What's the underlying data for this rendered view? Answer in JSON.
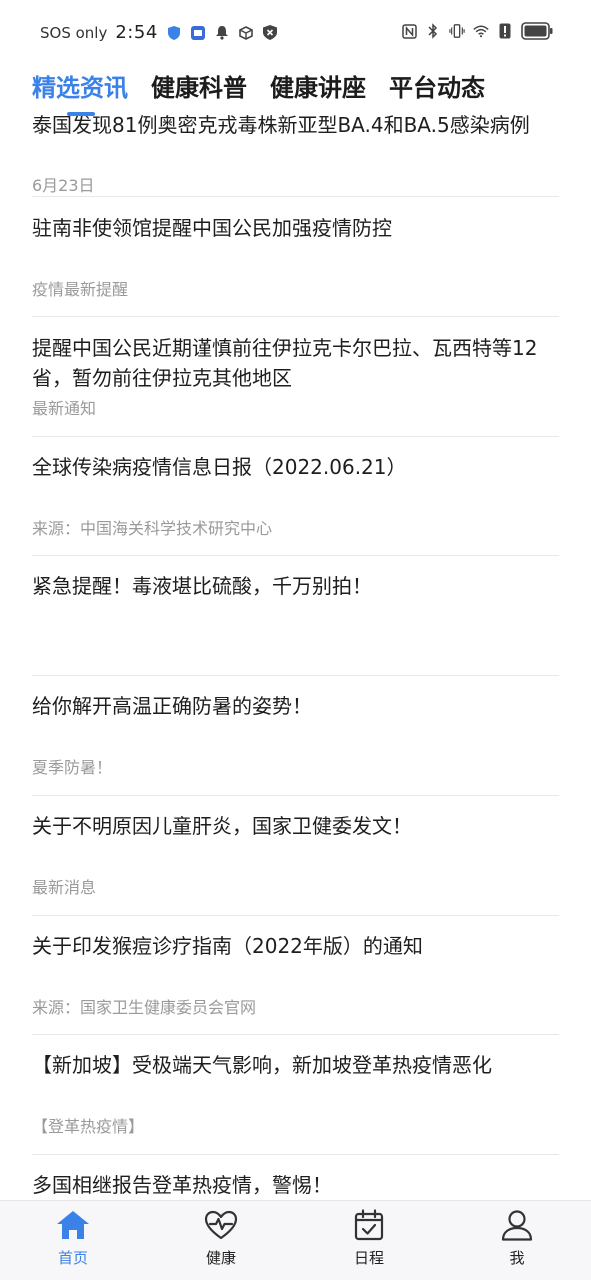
{
  "status": {
    "carrier": "SOS only",
    "time": "2:54"
  },
  "tabs": [
    {
      "label": "精选资讯",
      "active": true
    },
    {
      "label": "健康科普",
      "active": false
    },
    {
      "label": "健康讲座",
      "active": false
    },
    {
      "label": "平台动态",
      "active": false
    }
  ],
  "articles": [
    {
      "title": "泰国发现81例奥密克戎毒株新亚型BA.4和BA.5感染病例",
      "subtitle": "6月23日"
    },
    {
      "title": "驻南非使领馆提醒中国公民加强疫情防控",
      "subtitle": "疫情最新提醒"
    },
    {
      "title": "提醒中国公民近期谨慎前往伊拉克卡尔巴拉、瓦西特等12省，暂勿前往伊拉克其他地区",
      "subtitle": "最新通知"
    },
    {
      "title": "全球传染病疫情信息日报（2022.06.21）",
      "subtitle": "来源：中国海关科学技术研究中心"
    },
    {
      "title": "紧急提醒！毒液堪比硫酸，千万别拍！",
      "subtitle": ""
    },
    {
      "title": "给你解开高温正确防暑的姿势！",
      "subtitle": "夏季防暑！"
    },
    {
      "title": "关于不明原因儿童肝炎，国家卫健委发文！",
      "subtitle": "最新消息"
    },
    {
      "title": "关于印发猴痘诊疗指南（2022年版）的通知",
      "subtitle": "来源：国家卫生健康委员会官网"
    },
    {
      "title": "【新加坡】受极端天气影响，新加坡登革热疫情恶化",
      "subtitle": "【登革热疫情】"
    },
    {
      "title": "多国相继报告登革热疫情，警惕！",
      "subtitle": ""
    }
  ],
  "bottom_nav": [
    {
      "label": "首页",
      "icon": "home-icon",
      "active": true
    },
    {
      "label": "健康",
      "icon": "heart-pulse-icon",
      "active": false
    },
    {
      "label": "日程",
      "icon": "calendar-check-icon",
      "active": false
    },
    {
      "label": "我",
      "icon": "user-icon",
      "active": false
    }
  ],
  "colors": {
    "accent": "#3b82e8",
    "text": "#1e1e1e",
    "muted": "#9a9a9a"
  }
}
